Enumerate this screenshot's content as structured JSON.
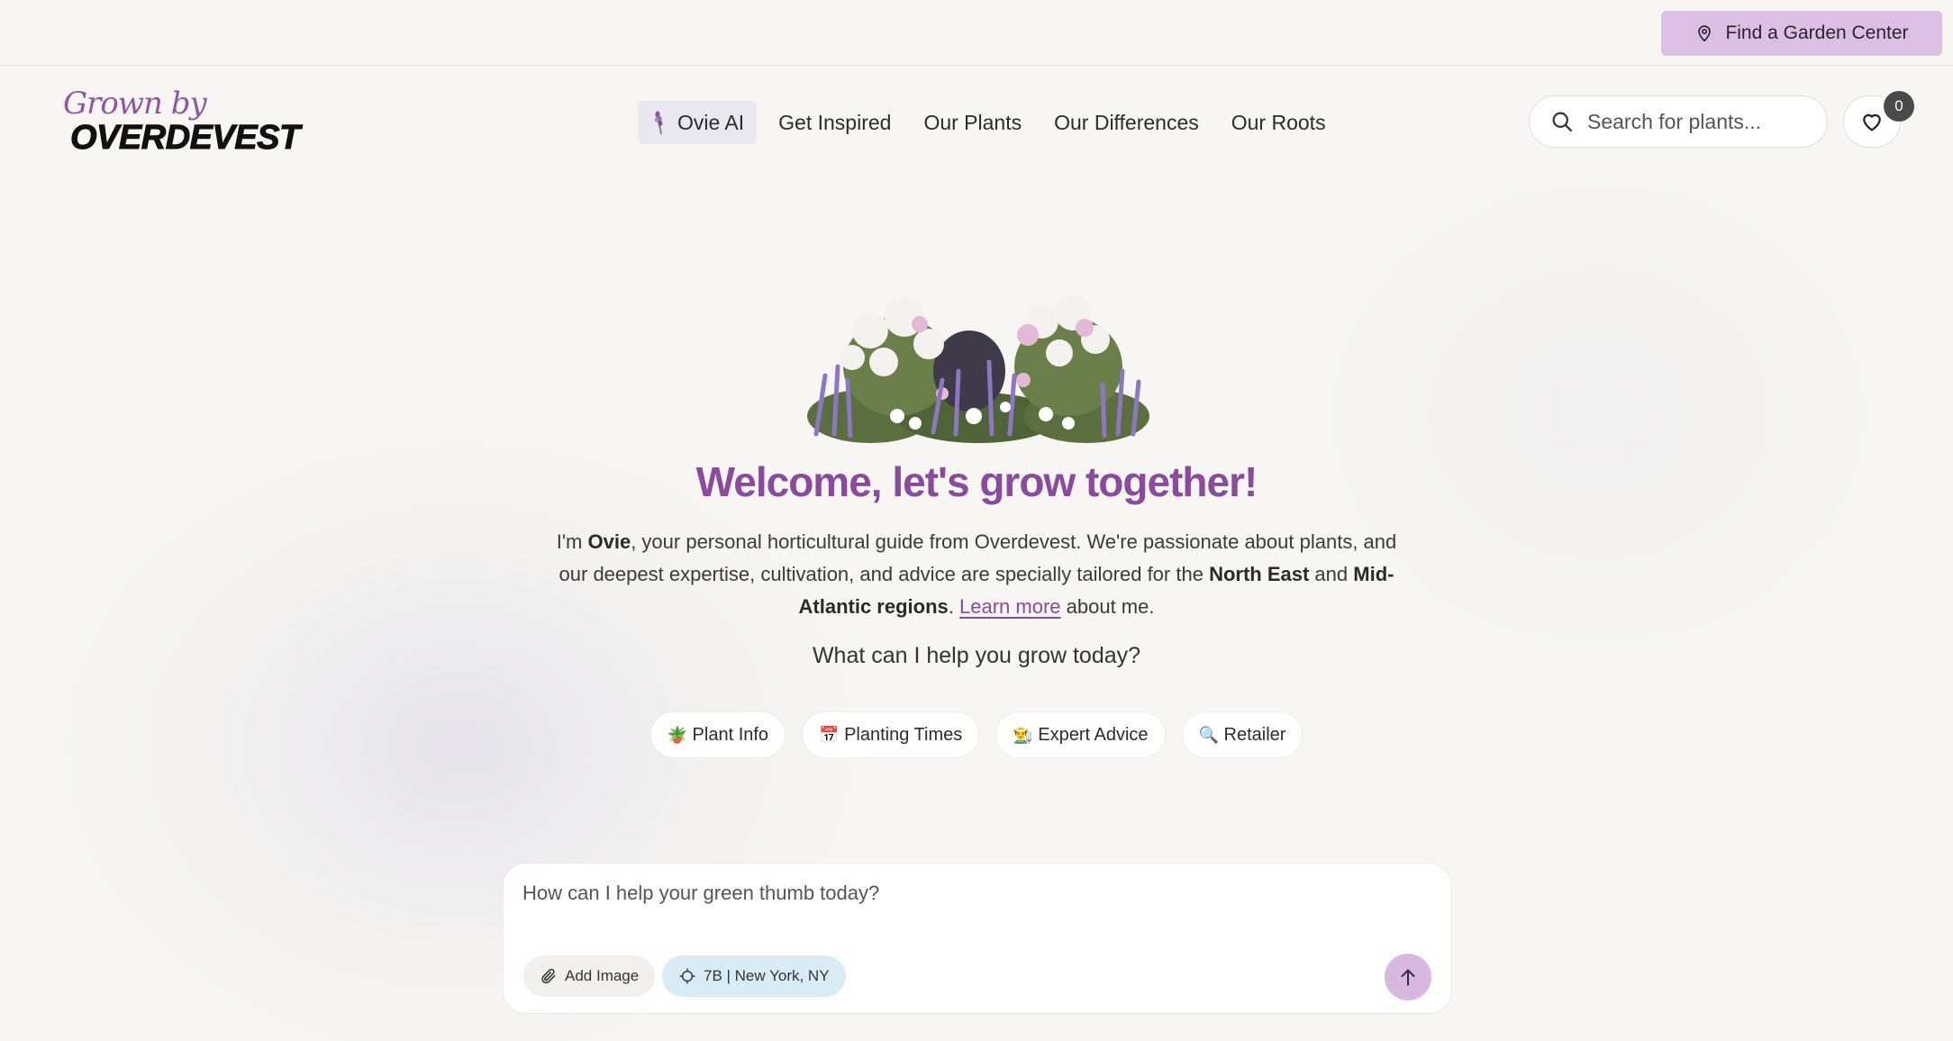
{
  "topbar": {
    "garden_center_label": "Find a Garden Center"
  },
  "logo": {
    "script": "Grown by",
    "brand": "OVERDEVEST"
  },
  "nav": {
    "items": [
      {
        "label": "Ovie AI",
        "active": true
      },
      {
        "label": "Get Inspired"
      },
      {
        "label": "Our Plants"
      },
      {
        "label": "Our Differences"
      },
      {
        "label": "Our Roots"
      }
    ]
  },
  "search": {
    "placeholder": "Search for plants..."
  },
  "favorites": {
    "count": "0"
  },
  "hero": {
    "welcome": "Welcome, let's grow together!",
    "intro_1": "I'm ",
    "intro_name": "Ovie",
    "intro_2": ", your personal horticultural guide from Overdevest. We're passionate about plants, and our deepest expertise, cultivation, and advice are specially tailored for the ",
    "intro_region_1": "North East",
    "intro_3": " and ",
    "intro_region_2": "Mid-Atlantic regions",
    "intro_4": ". ",
    "learn_more": "Learn more",
    "intro_5": " about me.",
    "help_question": "What can I help you grow today?"
  },
  "chips": [
    {
      "emoji": "🪴",
      "label": "Plant Info"
    },
    {
      "emoji": "📅",
      "label": "Planting Times"
    },
    {
      "emoji": "👨‍🌾",
      "label": "Expert Advice"
    },
    {
      "emoji": "🔍",
      "label": "Retailer"
    }
  ],
  "chat": {
    "placeholder": "How can I help your green thumb today?",
    "add_image_label": "Add Image",
    "location_label": "7B | New York, NY"
  },
  "colors": {
    "brand_purple": "#8a4a9e",
    "garden_button": "#dcc0e3",
    "send_button": "#d8b8df",
    "location_chip": "#d9ecf6"
  }
}
